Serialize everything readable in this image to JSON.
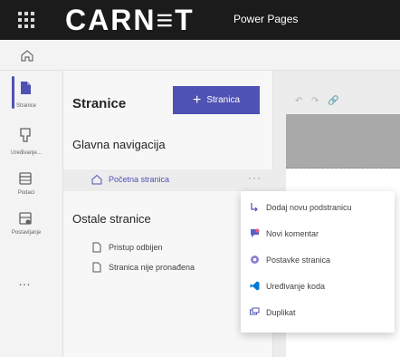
{
  "header": {
    "brand": "CARN≡T",
    "product": "Power Pages"
  },
  "rail": {
    "items": [
      {
        "label": "Stranice",
        "icon": "pages-icon",
        "active": true
      },
      {
        "label": "Uređivanje...",
        "icon": "styling-icon",
        "active": false
      },
      {
        "label": "Podaci",
        "icon": "data-icon",
        "active": false
      },
      {
        "label": "Postavljanje",
        "icon": "setup-icon",
        "active": false
      }
    ],
    "more": "…"
  },
  "panel": {
    "title": "Stranice",
    "add_button": "Stranica",
    "main_nav_heading": "Glavna navigacija",
    "main_nav_pages": [
      {
        "label": "Početna stranica",
        "icon": "home-icon",
        "selected": true
      }
    ],
    "other_heading": "Ostale stranice",
    "other_pages": [
      {
        "label": "Pristup odbijen",
        "icon": "page-icon"
      },
      {
        "label": "Stranica nije pronađena",
        "icon": "page-icon"
      }
    ],
    "more_glyph": "···"
  },
  "context_menu": {
    "items": [
      {
        "label": "Dodaj novu podstranicu",
        "icon": "subpage-icon"
      },
      {
        "label": "Novi komentar",
        "icon": "comment-icon"
      },
      {
        "label": "Postavke stranica",
        "icon": "settings-icon"
      },
      {
        "label": "Uređivanje koda",
        "icon": "vscode-icon"
      },
      {
        "label": "Duplikat",
        "icon": "duplicate-icon"
      }
    ]
  },
  "colors": {
    "accent": "#4f52b2",
    "topbar": "#1b1b1b"
  }
}
